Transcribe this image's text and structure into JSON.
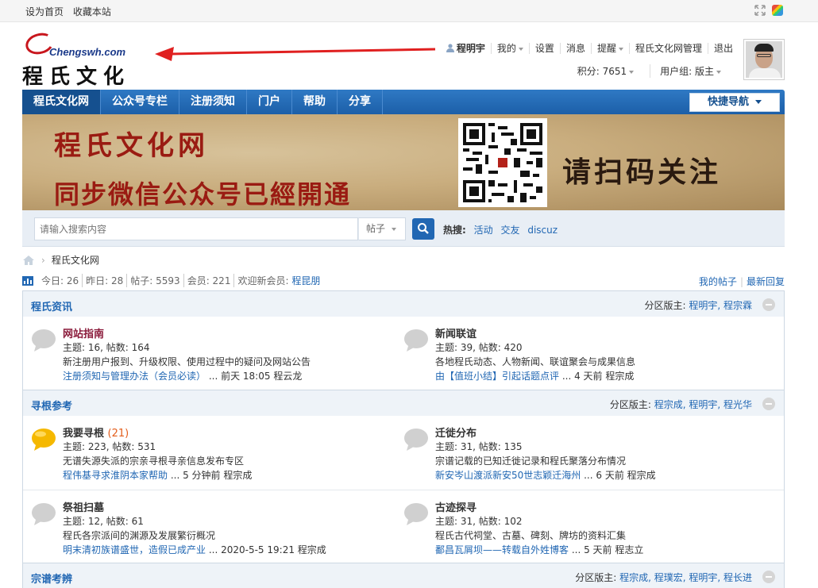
{
  "topbar": {
    "set_home": "设为首页",
    "bookmark": "收藏本站"
  },
  "logo": {
    "domain": "Chengswh.com",
    "chars": "程氏文化"
  },
  "user": {
    "name": "程明宇",
    "menu": [
      "我的",
      "设置",
      "消息",
      "提醒",
      "程氏文化网管理",
      "退出"
    ],
    "points_label": "积分: 7651",
    "group_label": "用户组: 版主"
  },
  "nav": {
    "tabs": [
      "程氏文化网",
      "公众号专栏",
      "注册须知",
      "门户",
      "帮助",
      "分享"
    ],
    "quick_nav": "快捷导航"
  },
  "banner": {
    "line1": "程氏文化网",
    "line2": "同步微信公众号已經開通",
    "scan": "请扫码关注"
  },
  "search": {
    "placeholder": "请输入搜索内容",
    "type": "帖子",
    "hot_label": "热搜:",
    "hot_terms": [
      "活动",
      "交友",
      "discuz"
    ]
  },
  "breadcrumb": {
    "current": "程氏文化网"
  },
  "stats": {
    "today": "今日: 26",
    "yesterday": "昨日: 28",
    "posts": "帖子: 5593",
    "members": "会员: 221",
    "welcome": "欢迎新会员:",
    "newest_member": "程昆朋",
    "my_posts": "我的帖子",
    "latest_reply": "最新回复"
  },
  "sections": [
    {
      "title": "程氏资讯",
      "mods_label": "分区版主:",
      "mods": "程明宇, 程宗霖",
      "forums": [
        {
          "name": "网站指南",
          "count": "",
          "stats": "主题: 16, 帖数: 164",
          "desc": "新注册用户报到、升级权限、使用过程中的疑问及网站公告",
          "last_link": "注册须知与管理办法（会员必读）",
          "last_meta": "... 前天 18:05 程云龙"
        },
        {
          "name": "新闻联谊",
          "count": "",
          "stats": "主题: 39, 帖数: 420",
          "desc": "各地程氏动态、人物新闻、联谊聚会与成果信息",
          "last_link": "由【值班小结】引起话题点评",
          "last_meta": "... 4 天前 程宗成"
        }
      ]
    },
    {
      "title": "寻根参考",
      "mods_label": "分区版主:",
      "mods": "程宗成, 程明宇, 程光华",
      "forums": [
        {
          "name": "我要寻根",
          "count": "(21)",
          "stats": "主题: 223, 帖数: 531",
          "desc": "无谱失源失派的宗亲寻根寻亲信息发布专区",
          "last_link": "程伟基寻求淮阴本家帮助",
          "last_meta": "... 5 分钟前 程宗成"
        },
        {
          "name": "迁徙分布",
          "count": "",
          "stats": "主题: 31, 帖数: 135",
          "desc": "宗谱记载的已知迁徙记录和程氏聚落分布情况",
          "last_link": "新安岑山渡派新安50世志颖迁海州",
          "last_meta": "... 6 天前 程宗成"
        },
        {
          "name": "祭祖扫墓",
          "count": "",
          "stats": "主题: 12, 帖数: 61",
          "desc": "程氏各宗派间的渊源及发展繁衍概况",
          "last_link": "明末清初族谱盛世，造假已成产业",
          "last_meta": "... 2020-5-5 19:21 程宗成"
        },
        {
          "name": "古迹探寻",
          "count": "",
          "stats": "主题: 31, 帖数: 102",
          "desc": "程氏古代祠堂、古墓、碑刻、牌坊的资料汇集",
          "last_link": "鄱昌瓦屑坝——转载自外姓博客",
          "last_meta": "... 5 天前 程志立"
        }
      ]
    },
    {
      "title": "宗谱考辨",
      "mods_label": "分区版主:",
      "mods": "程宗成, 程璞宏, 程明宇, 程长进",
      "forums": []
    }
  ]
}
